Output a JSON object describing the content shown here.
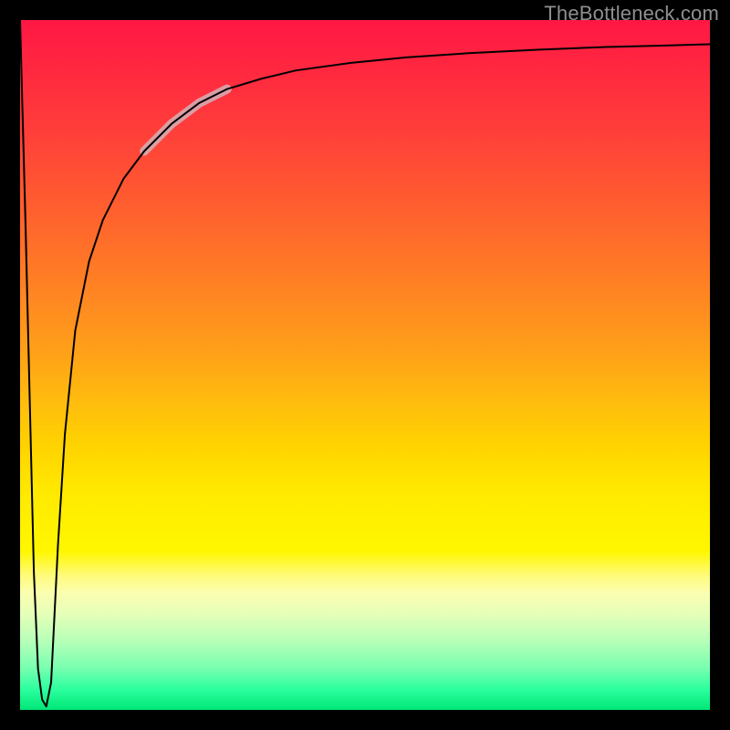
{
  "watermark": "TheBottleneck.com",
  "colors": {
    "frame": "#000000",
    "curve": "#000000",
    "highlight": "rgba(210,180,188,0.82)",
    "gradient_top": "#ff1744",
    "gradient_mid": "#ffe800",
    "gradient_bottom": "#00e676"
  },
  "chart_data": {
    "type": "line",
    "title": "",
    "xlabel": "",
    "ylabel": "",
    "xlim": [
      0,
      100
    ],
    "ylim": [
      0,
      100
    ],
    "grid": false,
    "legend": false,
    "series": [
      {
        "name": "bottleneck-curve",
        "x": [
          0.0,
          0.8,
          1.4,
          2.0,
          2.6,
          3.2,
          3.8,
          4.5,
          5.0,
          5.5,
          6.5,
          8.0,
          10.0,
          12.0,
          15.0,
          18.0,
          22.0,
          26.0,
          30.0,
          35.0,
          40.0,
          48.0,
          56.0,
          65.0,
          75.0,
          85.0,
          93.0,
          100.0
        ],
        "y": [
          100.0,
          70.0,
          45.0,
          20.0,
          6.0,
          1.5,
          0.5,
          4.0,
          14.0,
          24.0,
          40.0,
          55.0,
          65.0,
          71.0,
          77.0,
          81.0,
          85.0,
          88.0,
          90.0,
          91.5,
          92.7,
          93.8,
          94.6,
          95.2,
          95.7,
          96.1,
          96.3,
          96.5
        ]
      },
      {
        "name": "highlight-segment",
        "x": [
          18.0,
          22.0,
          26.0,
          30.0
        ],
        "y": [
          81.0,
          85.0,
          88.0,
          90.0
        ]
      }
    ]
  }
}
